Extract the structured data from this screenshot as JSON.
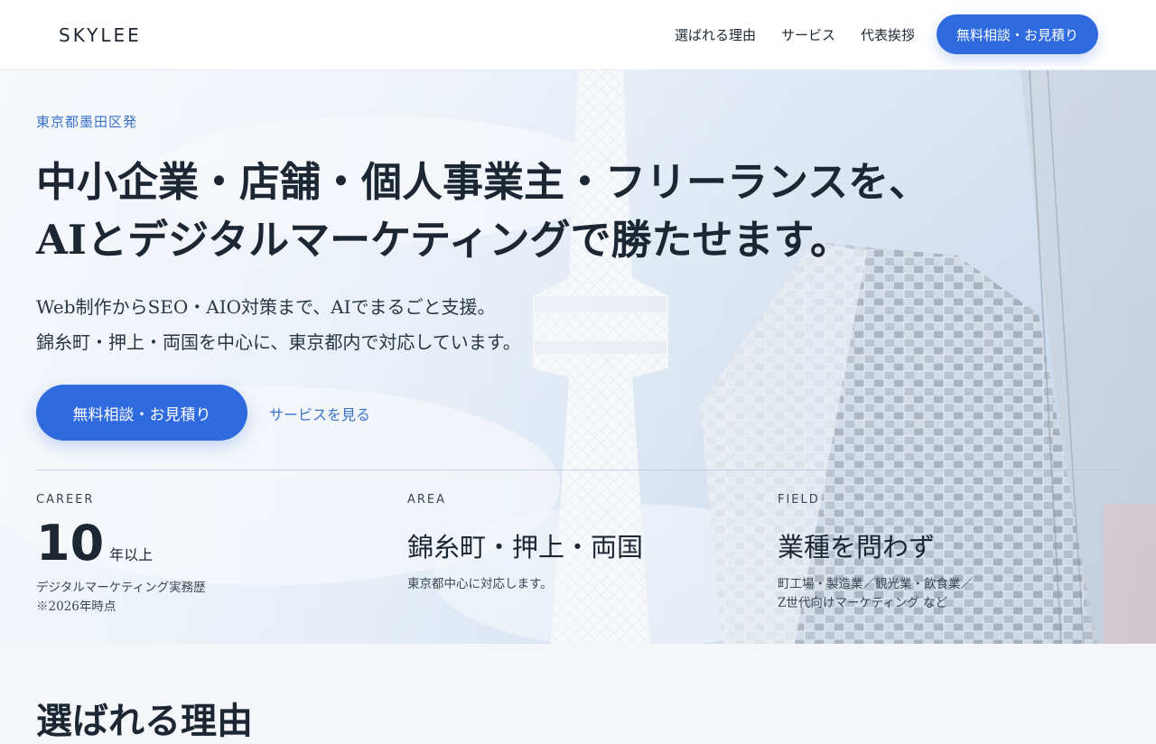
{
  "header": {
    "logo": "SKYLEE",
    "nav": [
      "選ばれる理由",
      "サービス",
      "代表挨拶"
    ],
    "cta": "無料相談・お見積り"
  },
  "hero": {
    "eyebrow": "東京都墨田区発",
    "headline_line1": "中小企業・店舗・個人事業主・フリーランスを、",
    "headline_line2": "AIとデジタルマーケティングで勝たせます。",
    "lead_line1": "Web制作からSEO・AIO対策まで、AIでまるごと支援。",
    "lead_line2": "錦糸町・押上・両国を中心に、東京都内で対応しています。",
    "cta": "無料相談・お見積り",
    "secondary_link": "サービスを見る"
  },
  "stats": {
    "career": {
      "label": "CAREER",
      "number": "10",
      "unit": "年以上",
      "note_line1": "デジタルマーケティング実務歴",
      "note_line2": "※2026年時点"
    },
    "area": {
      "label": "AREA",
      "value": "錦糸町・押上・両国",
      "note": "東京都中心に対応します。"
    },
    "field": {
      "label": "FIELD",
      "value": "業種を問わず",
      "note_line1": "町工場・製造業／観光業・飲食業／",
      "note_line2": "Z世代向けマーケティング など"
    }
  },
  "next_section": {
    "title": "選ばれる理由"
  },
  "colors": {
    "accent": "#2f6bde",
    "link": "#3a73c9",
    "text": "#1c2733"
  }
}
